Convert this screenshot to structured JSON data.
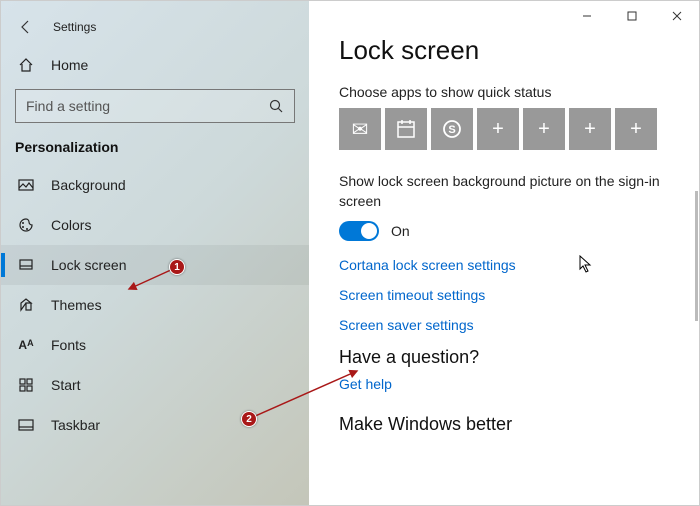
{
  "window": {
    "app_title": "Settings"
  },
  "sidebar": {
    "home_label": "Home",
    "search_placeholder": "Find a setting",
    "section_title": "Personalization",
    "items": [
      {
        "label": "Background"
      },
      {
        "label": "Colors"
      },
      {
        "label": "Lock screen"
      },
      {
        "label": "Themes"
      },
      {
        "label": "Fonts"
      },
      {
        "label": "Start"
      },
      {
        "label": "Taskbar"
      }
    ]
  },
  "content": {
    "heading": "Lock screen",
    "choose_apps_label": "Choose apps to show quick status",
    "tiles": [
      {
        "name": "mail-icon",
        "glyph": "✉"
      },
      {
        "name": "calendar-icon",
        "glyph": "svg"
      },
      {
        "name": "skype-icon",
        "glyph": "svg"
      },
      {
        "name": "add-icon",
        "glyph": "+"
      },
      {
        "name": "add-icon",
        "glyph": "+"
      },
      {
        "name": "add-icon",
        "glyph": "+"
      },
      {
        "name": "add-icon",
        "glyph": "+"
      }
    ],
    "show_lock_desc": "Show lock screen background picture on the sign-in screen",
    "toggle_state": "On",
    "links": [
      "Cortana lock screen settings",
      "Screen timeout settings",
      "Screen saver settings"
    ],
    "question_heading": "Have a question?",
    "get_help": "Get help",
    "cutoff_heading": "Make Windows better"
  },
  "annotations": {
    "marker1": "1",
    "marker2": "2"
  }
}
